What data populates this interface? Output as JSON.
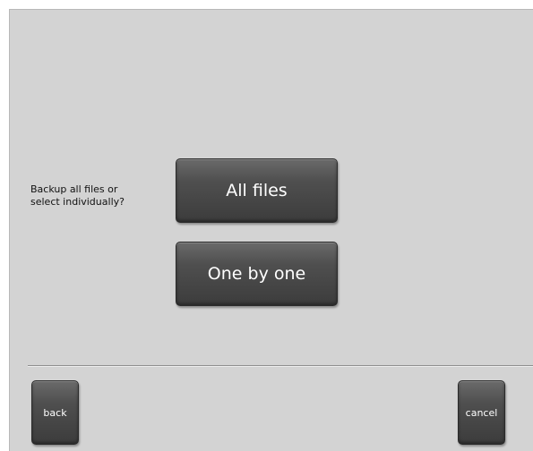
{
  "prompt": {
    "text": "Backup all files or\nselect individually?"
  },
  "options": {
    "all_files_label": "All files",
    "one_by_one_label": "One by one"
  },
  "footer": {
    "back_label": "back",
    "cancel_label": "cancel"
  },
  "colors": {
    "background": "#d3d3d3",
    "button_top": "#6a6a6a",
    "button_bottom": "#3c3c3c",
    "button_text": "#ffffff"
  }
}
